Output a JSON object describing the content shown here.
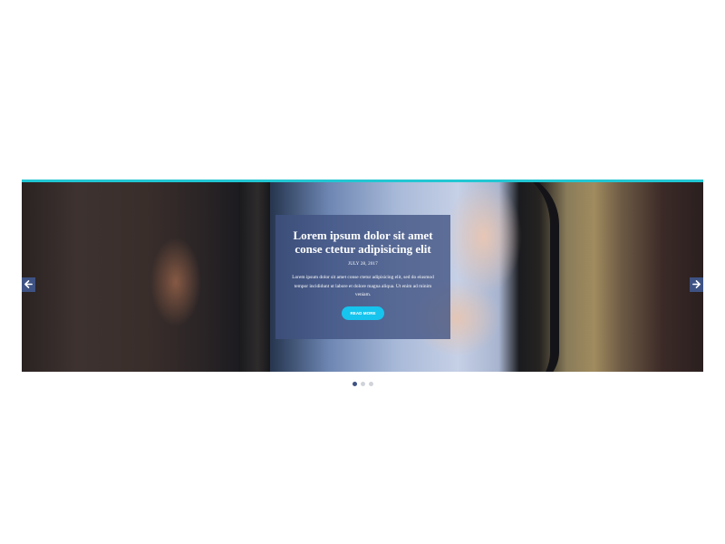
{
  "slider": {
    "accent_color": "#22c7d3",
    "slide": {
      "image_icon": "car-mirror-photo",
      "title": "Lorem ipsum dolor sit amet conse ctetur adipisicing elit",
      "date": "JULY 28, 2017",
      "text": "Lorem ipsum dolor sit amet conse ctetur adipisicing elit, sed do eiusmod tempor incididunt ut labore et dolore magna aliqua. Ut enim ad minim veniam.",
      "button_label": "READ MORE"
    },
    "prev_icon": "arrow-left-icon",
    "next_icon": "arrow-right-icon",
    "pagination": {
      "count": 3,
      "active_index": 0
    }
  }
}
